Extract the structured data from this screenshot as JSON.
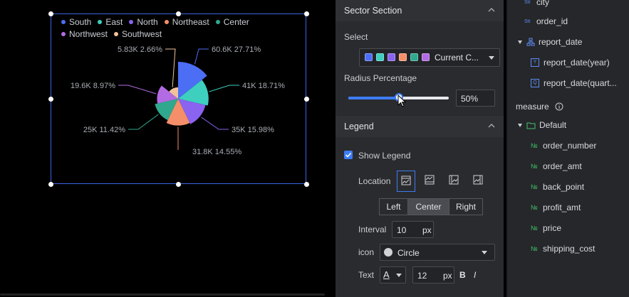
{
  "chart": {
    "legend": [
      {
        "name": "South",
        "color": "#4c6ef5"
      },
      {
        "name": "East",
        "color": "#3ecfbf"
      },
      {
        "name": "North",
        "color": "#8a63f0"
      },
      {
        "name": "Northeast",
        "color": "#f58f6a"
      },
      {
        "name": "Center",
        "color": "#2fa88e"
      },
      {
        "name": "Northwest",
        "color": "#b36be3"
      },
      {
        "name": "Southwest",
        "color": "#f2c29b"
      }
    ]
  },
  "chart_data": {
    "type": "pie",
    "variant": "rose",
    "categories": [
      "South",
      "East",
      "North",
      "Northeast",
      "Center",
      "Northwest",
      "Southwest"
    ],
    "values": [
      60600,
      41000,
      35000,
      31800,
      25000,
      19600,
      5830
    ],
    "value_labels": [
      "60.6K",
      "41K",
      "35K",
      "31.8K",
      "25K",
      "19.6K",
      "5.83K"
    ],
    "percent_labels": [
      "27.71%",
      "18.71%",
      "15.98%",
      "14.55%",
      "11.42%",
      "8.97%",
      "2.66%"
    ],
    "colors": [
      "#4c6ef5",
      "#3ecfbf",
      "#8a63f0",
      "#f58f6a",
      "#2fa88e",
      "#b36be3",
      "#f2c29b"
    ],
    "legend_position": "top"
  },
  "panel": {
    "sector_section": "Sector Section",
    "select_label": "Select",
    "select_value": "Current C...",
    "swatches": [
      "#4c6ef5",
      "#3ecfbf",
      "#8a63f0",
      "#f58f6a",
      "#2fa88e",
      "#b36be3"
    ],
    "radius_label": "Radius Percentage",
    "radius_value": "50%",
    "radius_percent": 50,
    "legend_section": "Legend",
    "show_legend": "Show Legend",
    "location_label": "Location",
    "align_options": [
      "Left",
      "Center",
      "Right"
    ],
    "align_selected": "Center",
    "interval_label": "Interval",
    "interval_value": "10",
    "interval_unit": "px",
    "icon_label": "icon",
    "icon_value": "Circle",
    "text_label": "Text",
    "text_size": "12",
    "text_unit": "px",
    "bold_label": "B",
    "italic_label": "I",
    "font_color_label": "A"
  },
  "tree": {
    "city": "city",
    "order_id": "order_id",
    "report_date": "report_date",
    "report_date_year": "report_date(year)",
    "report_date_quarter": "report_date(quart...",
    "measure_label": "measure",
    "default_folder": "Default",
    "measures": [
      "order_number",
      "order_amt",
      "back_point",
      "profit_amt",
      "price",
      "shipping_cost"
    ],
    "type_str": "Str",
    "type_num": "№",
    "type_year": "Y",
    "type_quarter": "Q"
  }
}
